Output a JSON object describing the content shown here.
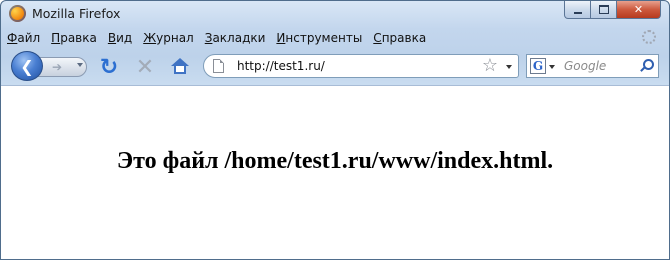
{
  "window": {
    "title": "Mozilla Firefox",
    "controls": {
      "minimize": "minimize",
      "maximize": "maximize",
      "close": "close"
    }
  },
  "menu": {
    "items": [
      "Файл",
      "Правка",
      "Вид",
      "Журнал",
      "Закладки",
      "Инструменты",
      "Справка"
    ]
  },
  "toolbar": {
    "back_icon": "back-arrow-icon",
    "forward_icon": "forward-arrow-icon",
    "reload_icon": "reload-icon",
    "stop_icon": "stop-icon",
    "home_icon": "home-icon"
  },
  "address": {
    "url": "http://test1.ru/",
    "bookmark_icon": "star-icon"
  },
  "search": {
    "engine": "Google",
    "engine_glyph": "G",
    "placeholder": "Google"
  },
  "page": {
    "heading": "Это файл /home/test1.ru/www/index.html."
  },
  "colors": {
    "chrome": "#c3d6ed",
    "close_button": "#cd5a3e",
    "accent": "#2c6fd1"
  }
}
